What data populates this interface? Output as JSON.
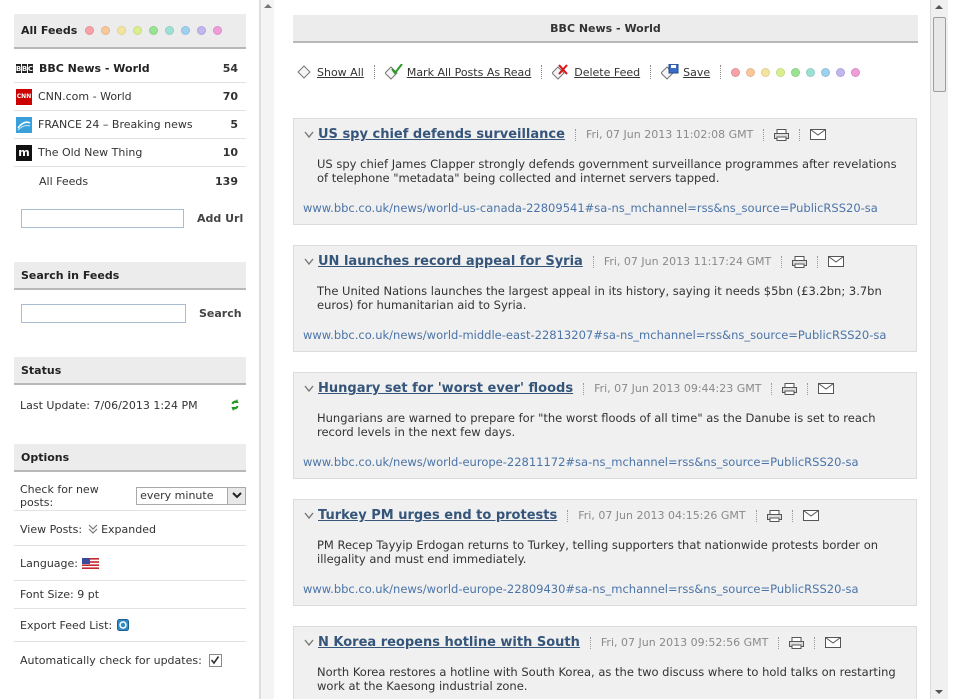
{
  "sidebar": {
    "feeds_header": "All Feeds",
    "header_dot_colors": [
      "#f7a1a8",
      "#f9c79c",
      "#f5e49c",
      "#d9ef8f",
      "#9be293",
      "#9ee0d6",
      "#9fd1ef",
      "#c2b5f0",
      "#ef9cd9"
    ],
    "feeds": [
      {
        "name": "BBC News - World",
        "count": "54",
        "icon": "bbc-logo-icon",
        "active": true
      },
      {
        "name": "CNN.com - World",
        "count": "70",
        "icon": "cnn-logo-icon",
        "active": false
      },
      {
        "name": "FRANCE 24 – Breaking news",
        "count": "5",
        "icon": "france24-logo-icon",
        "active": false
      },
      {
        "name": "The Old New Thing",
        "count": "10",
        "icon": "oldnewthing-logo-icon",
        "active": false
      },
      {
        "name": "All Feeds",
        "count": "139",
        "icon": "",
        "active": false
      }
    ],
    "add_url": {
      "value": "",
      "button": "Add Url"
    },
    "search": {
      "header": "Search in Feeds",
      "value": "",
      "button": "Search"
    },
    "status": {
      "header": "Status",
      "last_update": "Last Update: 7/06/2013 1:24 PM"
    },
    "options": {
      "header": "Options",
      "check_label": "Check for new posts:",
      "check_value": "every minute",
      "view_label": "View Posts:",
      "view_value": "Expanded",
      "language_label": "Language:",
      "font_size_label": "Font Size: 9 pt",
      "export_label": "Export Feed List:",
      "auto_update_label": "Automatically check for updates:",
      "auto_update_checked": true
    }
  },
  "main": {
    "title": "BBC News - World",
    "toolbar": {
      "show_all": "Show All",
      "mark_read": "Mark All Posts As Read",
      "delete_feed": "Delete Feed",
      "save": "Save",
      "dot_colors": [
        "#f7a1a8",
        "#f9c79c",
        "#f5e49c",
        "#d9ef8f",
        "#9be293",
        "#9ee0d6",
        "#9fd1ef",
        "#c2b5f0",
        "#ef9cd9"
      ]
    },
    "posts": [
      {
        "title": "US spy chief defends surveillance",
        "date": "Fri, 07 Jun 2013 11:02:08 GMT",
        "description": "US spy chief James Clapper strongly defends government surveillance programmes after revelations of telephone \"metadata\" being collected and internet servers tapped.",
        "link": "www.bbc.co.uk/news/world-us-canada-22809541#sa-ns_mchannel=rss&ns_source=PublicRSS20-sa"
      },
      {
        "title": "UN launches record appeal for Syria",
        "date": "Fri, 07 Jun 2013 11:17:24 GMT",
        "description": "The United Nations launches the largest appeal in its history, saying it needs $5bn (£3.2bn; 3.7bn euros) for humanitarian aid to Syria.",
        "link": "www.bbc.co.uk/news/world-middle-east-22813207#sa-ns_mchannel=rss&ns_source=PublicRSS20-sa"
      },
      {
        "title": "Hungary set for 'worst ever' floods",
        "date": "Fri, 07 Jun 2013 09:44:23 GMT",
        "description": "Hungarians are warned to prepare for \"the worst floods of all time\" as the Danube is set to reach record levels in the next few days.",
        "link": "www.bbc.co.uk/news/world-europe-22811172#sa-ns_mchannel=rss&ns_source=PublicRSS20-sa"
      },
      {
        "title": "Turkey PM urges end to protests",
        "date": "Fri, 07 Jun 2013 04:15:26 GMT",
        "description": "PM Recep Tayyip Erdogan returns to Turkey, telling supporters that nationwide protests border on illegality and must end immediately.",
        "link": "www.bbc.co.uk/news/world-europe-22809430#sa-ns_mchannel=rss&ns_source=PublicRSS20-sa"
      },
      {
        "title": "N Korea reopens hotline with South",
        "date": "Fri, 07 Jun 2013 09:52:56 GMT",
        "description": "North Korea restores a hotline with South Korea, as the two discuss where to hold talks on restarting work at the Kaesong industrial zone.",
        "link": ""
      }
    ]
  }
}
